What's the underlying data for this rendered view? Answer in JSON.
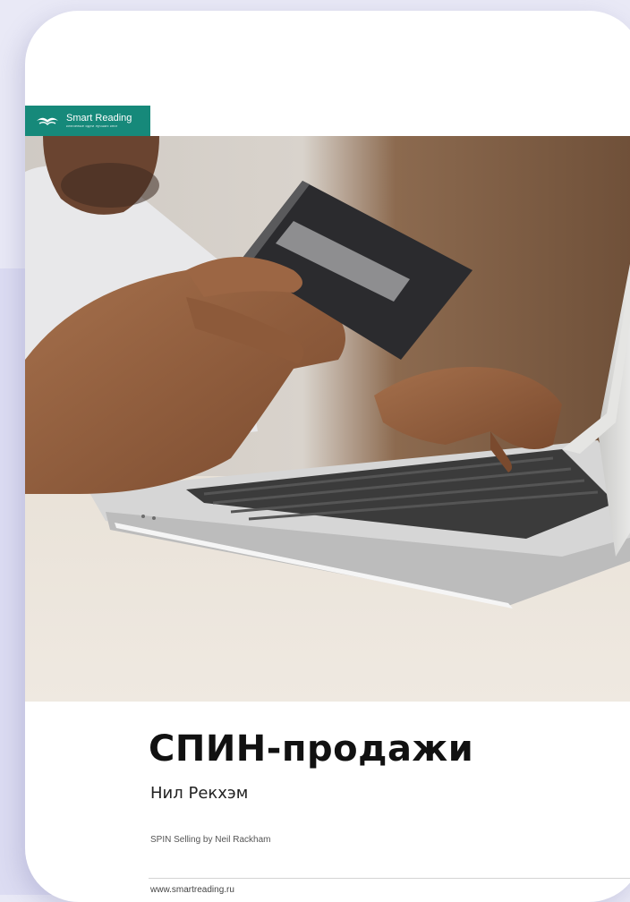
{
  "logo": {
    "name": "Smart Reading",
    "tagline": "ключевые идеи лучших книг"
  },
  "book": {
    "title": "СПИН-продажи",
    "author": "Нил Рекхэм",
    "original": "SPIN Selling by Neil Rackham",
    "website": "www.smartreading.ru"
  },
  "colors": {
    "accent": "#16897a",
    "page_bg": "#e9e9f6"
  }
}
